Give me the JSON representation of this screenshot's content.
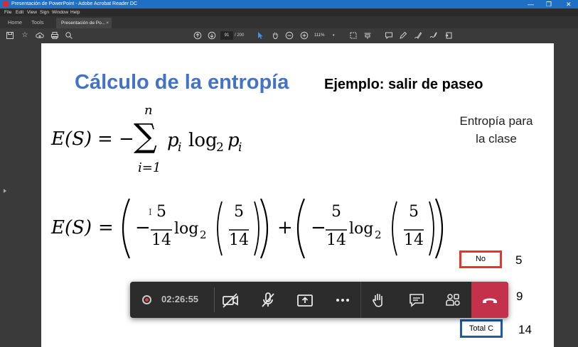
{
  "window": {
    "title": "Presentación de PowerPoint - Adobe Acrobat Reader DC",
    "controls": [
      "—",
      "❐",
      "✕"
    ]
  },
  "menubar": [
    "File",
    "Edit",
    "View",
    "Sign",
    "Window",
    "Help"
  ],
  "tabs": {
    "home": "Home",
    "tools": "Tools",
    "document": "Presentación de Po...",
    "close": "×"
  },
  "toolbar": {
    "page_current": "91",
    "page_total": "/ 200",
    "zoom": "111%"
  },
  "slide": {
    "title": "Cálculo de la entropía",
    "subtitle": "Ejemplo: salir de paseo",
    "entropy_note_line1": "Entropía para",
    "entropy_note_line2": "la clase",
    "formula1": {
      "lhs": "E(S)",
      "eq": "= −",
      "sigma": "∑",
      "upper": "n",
      "lower": "i=1",
      "term_p": "p",
      "sub_i": "i",
      "log": "log",
      "base": "2"
    },
    "formula2": {
      "lhs": "E(S)",
      "eq": "=",
      "minus": "−",
      "num": "5",
      "den": "14",
      "log": "log",
      "base": "2",
      "plus": "+",
      "cursor": "I"
    },
    "label_no": "No",
    "count_no": "5",
    "count_yes": "9",
    "label_total": "Total C",
    "count_total": "14"
  },
  "meeting": {
    "elapsed": "02:26:55"
  }
}
